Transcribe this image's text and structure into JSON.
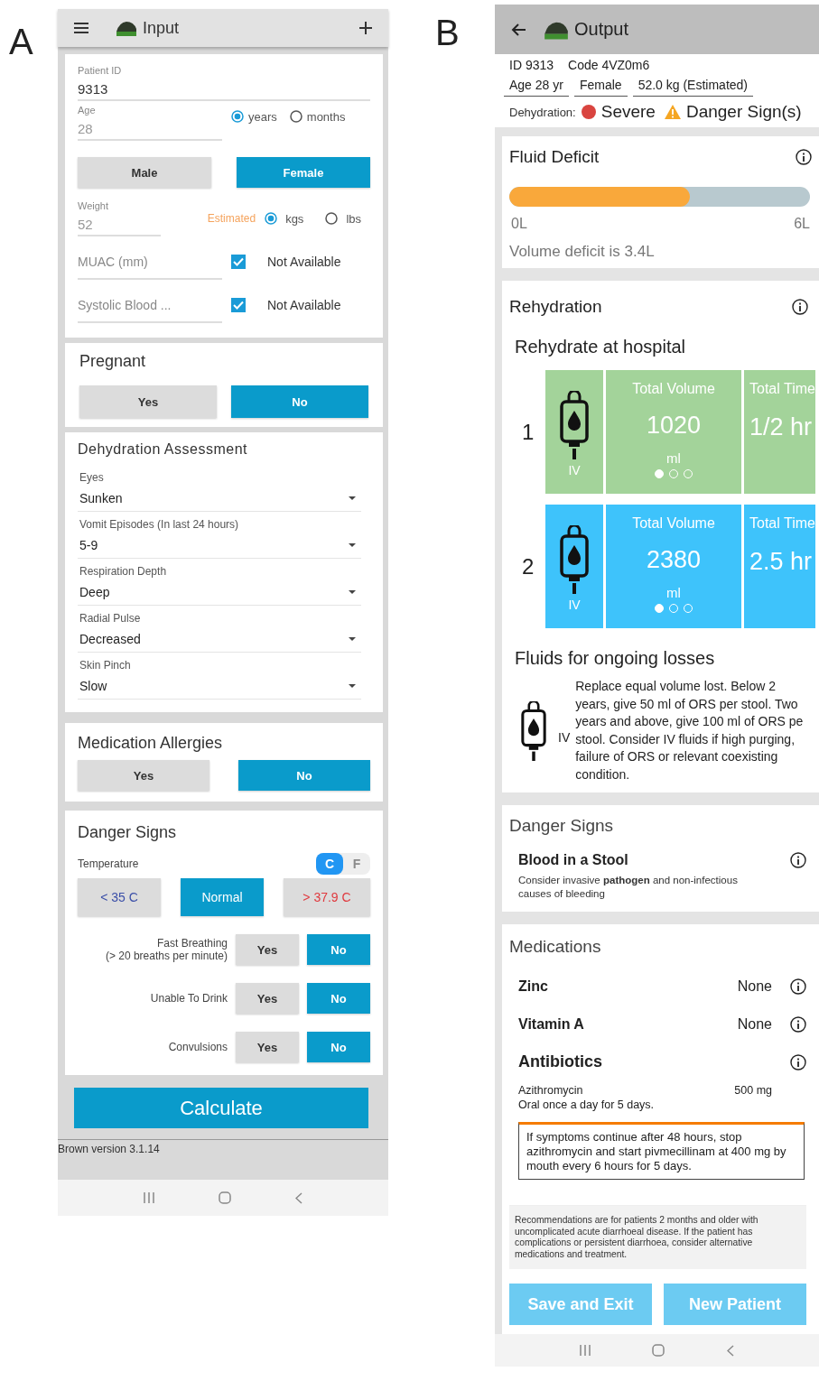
{
  "panel_a": {
    "letter": "A",
    "app_bar": {
      "title": "Input"
    },
    "patient_id": {
      "label": "Patient ID",
      "value": "9313"
    },
    "age": {
      "label": "Age",
      "value": "28",
      "units": [
        {
          "label": "years",
          "selected": true
        },
        {
          "label": "months",
          "selected": false
        }
      ]
    },
    "sex": [
      {
        "label": "Male",
        "selected": false
      },
      {
        "label": "Female",
        "selected": true
      }
    ],
    "weight": {
      "label": "Weight",
      "value": "52",
      "note": "Estimated",
      "units": [
        {
          "label": "kgs",
          "selected": true
        },
        {
          "label": "lbs",
          "selected": false
        }
      ]
    },
    "optional_fields": [
      {
        "placeholder": "MUAC (mm)",
        "checked": true,
        "check_label": "Not Available"
      },
      {
        "placeholder": "Systolic Blood ...",
        "checked": true,
        "check_label": "Not Available"
      }
    ],
    "pregnant": {
      "title": "Pregnant",
      "options": [
        {
          "label": "Yes",
          "selected": false
        },
        {
          "label": "No",
          "selected": true
        }
      ]
    },
    "dehydration": {
      "title": "Dehydration Assessment",
      "fields": [
        {
          "label": "Eyes",
          "value": "Sunken"
        },
        {
          "label": "Vomit Episodes (In last 24 hours)",
          "value": "5-9"
        },
        {
          "label": "Respiration Depth",
          "value": "Deep"
        },
        {
          "label": "Radial Pulse",
          "value": "Decreased"
        },
        {
          "label": "Skin Pinch",
          "value": "Slow"
        }
      ]
    },
    "allergies": {
      "title": "Medication Allergies",
      "options": [
        {
          "label": "Yes",
          "selected": false
        },
        {
          "label": "No",
          "selected": true
        }
      ]
    },
    "danger_signs": {
      "title": "Danger Signs",
      "temperature_label": "Temperature",
      "scale": [
        {
          "label": "C",
          "selected": true
        },
        {
          "label": "F",
          "selected": false
        }
      ],
      "temperature": [
        {
          "label": "< 35 C",
          "kind": "low",
          "selected": false
        },
        {
          "label": "Normal",
          "kind": "normal",
          "selected": true
        },
        {
          "label": "> 37.9 C",
          "kind": "high",
          "selected": false
        }
      ],
      "questions": [
        {
          "label": "Fast Breathing",
          "sublabel": "(> 20 breaths per minute)",
          "options": [
            {
              "label": "Yes",
              "selected": false
            },
            {
              "label": "No",
              "selected": true
            }
          ]
        },
        {
          "label": "Unable To Drink",
          "options": [
            {
              "label": "Yes",
              "selected": false
            },
            {
              "label": "No",
              "selected": true
            }
          ]
        },
        {
          "label": "Convulsions",
          "options": [
            {
              "label": "Yes",
              "selected": false
            },
            {
              "label": "No",
              "selected": true
            }
          ]
        }
      ]
    },
    "calculate_button": "Calculate",
    "version": "Brown version 3.1.14"
  },
  "panel_b": {
    "letter": "B",
    "app_bar": {
      "title": "Output"
    },
    "summary": {
      "id": "ID  9313",
      "code": "Code  4VZ0m6",
      "details": [
        "Age 28 yr",
        "Female",
        "52.0 kg  (Estimated)"
      ],
      "dehydration_label": "Dehydration:",
      "severity": {
        "label": "Severe",
        "color": "#d9443f"
      },
      "warning": "Danger Sign(s)"
    },
    "fluid_deficit": {
      "title": "Fluid Deficit",
      "level": 0.6,
      "min": "0L",
      "max": "6L",
      "text": "Volume deficit is 3.4L"
    },
    "rehydration": {
      "title": "Rehydration",
      "subtitle": "Rehydrate at hospital",
      "steps": [
        {
          "number": "1",
          "route": "IV",
          "color": "#a3d39a",
          "volume_label": "Total Volume",
          "volume": "1020",
          "unit": "ml",
          "time_label": "Total Time",
          "time": "1/2 hr",
          "pages": [
            {
              "selected": true
            },
            {
              "selected": false
            },
            {
              "selected": false
            }
          ]
        },
        {
          "number": "2",
          "route": "IV",
          "color": "#3ec3fb",
          "volume_label": "Total Volume",
          "volume": "2380",
          "unit": "ml",
          "time_label": "Total Time",
          "time": "2.5 hr",
          "pages": [
            {
              "selected": true
            },
            {
              "selected": false
            },
            {
              "selected": false
            }
          ]
        }
      ]
    },
    "ongoing_losses": {
      "title": "Fluids for ongoing losses",
      "route": "IV",
      "lines": [
        "Replace equal volume lost. Below 2",
        "years, give 50 ml of ORS per stool. Two",
        "years and above, give 100 ml of ORS pe",
        "stool. Consider IV fluids if high purging,",
        "failure of ORS or relevant coexisting",
        "condition."
      ]
    },
    "danger_signs": {
      "title": "Danger Signs",
      "items": [
        {
          "name": "Blood in a Stool",
          "text": "Consider invasive **pathogen** and non-infectious causes of bleeding"
        }
      ]
    },
    "medications": {
      "title": "Medications",
      "items": [
        {
          "kind": "simple",
          "name": "Zinc",
          "dose": "None"
        },
        {
          "kind": "simple",
          "name": "Vitamin A",
          "dose": "None"
        },
        {
          "kind": "detailed",
          "name": "Antibiotics",
          "drug": "Azithromycin",
          "dose": "500 mg",
          "instructions": "Oral once a day for 5 days.",
          "warning": "If symptoms continue after 48 hours, stop azithromycin and start pivmecillinam at 400 mg by mouth every 6 hours for 5 days."
        }
      ]
    },
    "disclaimer": "Recommendations are for patients 2 months and older with uncomplicated acute diarrhoeal disease. If the patient has complications or persistent diarrhoea, consider alternative medications and treatment.",
    "buttons": [
      "Save and Exit",
      "New Patient"
    ]
  }
}
